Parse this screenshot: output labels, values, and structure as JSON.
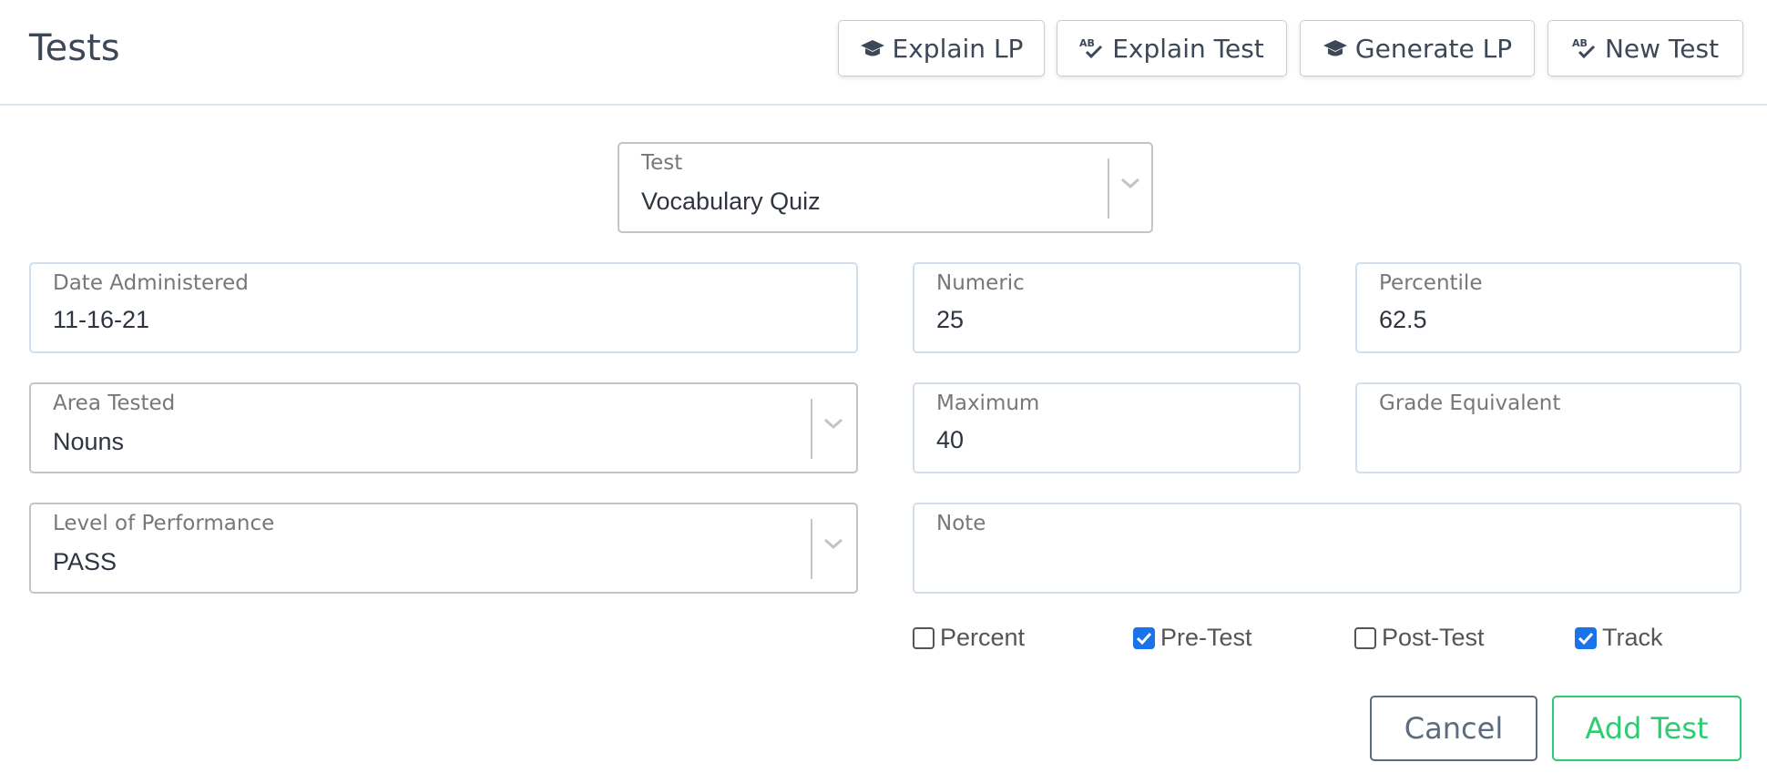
{
  "header": {
    "title": "Tests",
    "buttons": [
      {
        "label": "Explain LP",
        "icon": "graduation-cap-icon"
      },
      {
        "label": "Explain Test",
        "icon": "spellcheck-icon"
      },
      {
        "label": "Generate LP",
        "icon": "graduation-cap-icon"
      },
      {
        "label": "New Test",
        "icon": "spellcheck-icon"
      }
    ]
  },
  "form": {
    "test": {
      "label": "Test",
      "value": "Vocabulary Quiz"
    },
    "date_administered": {
      "label": "Date Administered",
      "value": "11-16-21"
    },
    "numeric": {
      "label": "Numeric",
      "value": "25"
    },
    "percentile": {
      "label": "Percentile",
      "value": "62.5"
    },
    "area_tested": {
      "label": "Area Tested",
      "value": "Nouns"
    },
    "maximum": {
      "label": "Maximum",
      "value": "40"
    },
    "grade_equivalent": {
      "label": "Grade Equivalent",
      "value": ""
    },
    "level_of_performance": {
      "label": "Level of Performance",
      "value": "PASS"
    },
    "note": {
      "label": "Note",
      "value": ""
    }
  },
  "checkboxes": [
    {
      "label": "Percent",
      "checked": false
    },
    {
      "label": "Pre-Test",
      "checked": true
    },
    {
      "label": "Post-Test",
      "checked": false
    },
    {
      "label": "Track",
      "checked": true
    }
  ],
  "footer": {
    "cancel_label": "Cancel",
    "add_label": "Add Test"
  },
  "colors": {
    "accent_green": "#2ecc71",
    "checkbox_blue": "#1a73e8",
    "text": "#3c4858"
  }
}
